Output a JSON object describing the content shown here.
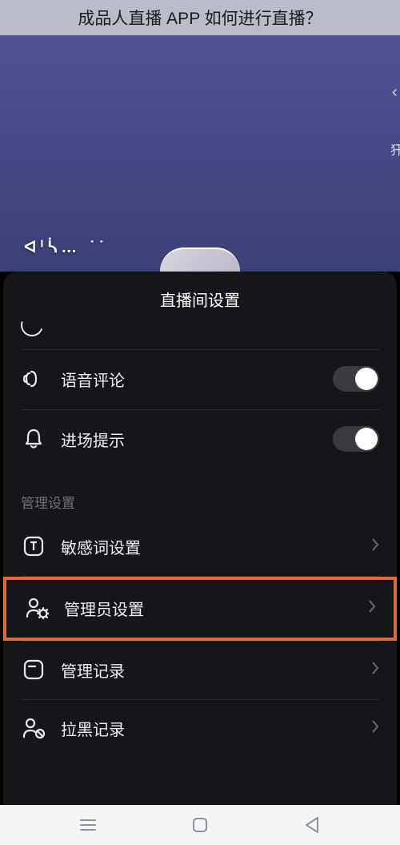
{
  "page_title": "成品人直播 APP 如何进行直播？",
  "background_text": "ᐊᑊᓵ…   ˙˙",
  "sheet": {
    "title": "直播间设置",
    "toggle_items": [
      {
        "icon": "sound-icon",
        "label": "语音评论",
        "on": true
      },
      {
        "icon": "bell-icon",
        "label": "进场提示",
        "on": true
      }
    ],
    "section_label": "管理设置",
    "manage_items": [
      {
        "icon": "text-box-icon",
        "label": "敏感词设置",
        "highlighted": false
      },
      {
        "icon": "admin-icon",
        "label": "管理员设置",
        "highlighted": true
      },
      {
        "icon": "record-icon",
        "label": "管理记录",
        "highlighted": false
      },
      {
        "icon": "block-icon",
        "label": "拉黑记录",
        "highlighted": false
      }
    ]
  }
}
